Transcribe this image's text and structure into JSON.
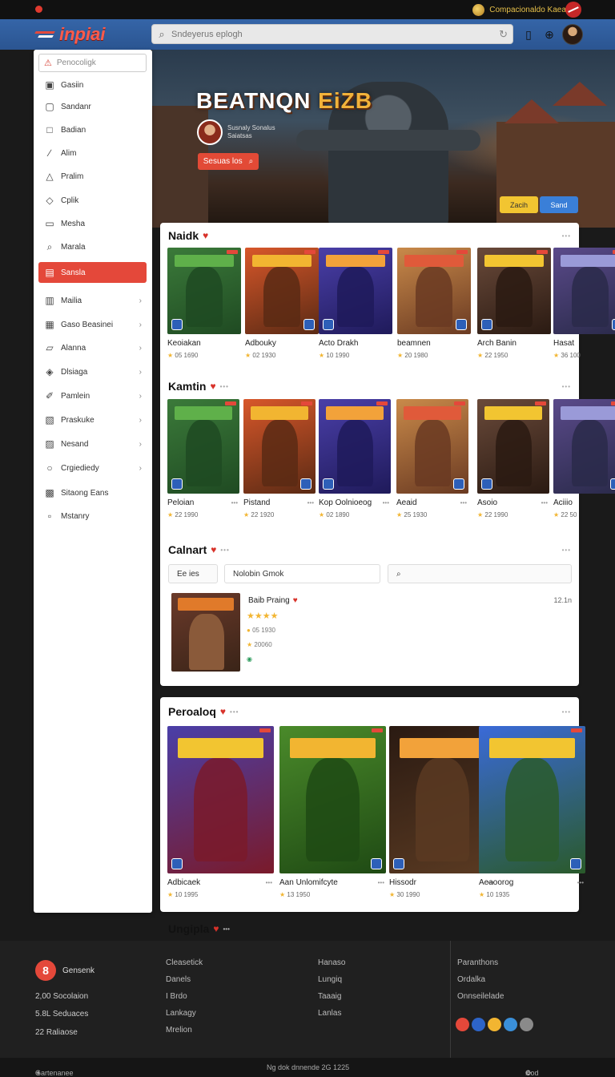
{
  "topbar": {
    "promo_text": "Compacionaldo Kaeal-9"
  },
  "header": {
    "logo_text": "inpiai",
    "search_placeholder": "Sndeyerus eplogh"
  },
  "hero": {
    "title_main": "BEATNQN ",
    "title_accent": "EiZB",
    "profile_line1": "Susnaly Sonalus",
    "profile_line2": "Saiatsas",
    "cta_label": "Sesuas los",
    "pill_yellow": "Zacih",
    "pill_blue": "Sand"
  },
  "sidebar": {
    "search_placeholder": "Penocoligk",
    "items": [
      {
        "label": "Gasiin",
        "icon": "gamepad-icon"
      },
      {
        "label": "Sandanr",
        "icon": "dice-icon"
      },
      {
        "label": "Badian",
        "icon": "box-icon"
      },
      {
        "label": "Alim",
        "icon": "sword-icon"
      },
      {
        "label": "Pralim",
        "icon": "tent-icon"
      },
      {
        "label": "Cplik",
        "icon": "controller-icon"
      },
      {
        "label": "Mesha",
        "icon": "monitor-icon"
      },
      {
        "label": "Marala",
        "icon": "search-icon"
      },
      {
        "label": "Sansla",
        "icon": "star-icon"
      },
      {
        "label": "Mailia",
        "icon": "card-icon"
      },
      {
        "label": "Gaso Beasinei",
        "icon": "store-icon"
      },
      {
        "label": "Alanna",
        "icon": "shield-icon"
      },
      {
        "label": "Dlsiaga",
        "icon": "puzzle-icon"
      },
      {
        "label": "Pamlein",
        "icon": "brush-icon"
      },
      {
        "label": "Praskuke",
        "icon": "film-icon"
      },
      {
        "label": "Nesand",
        "icon": "layers-icon"
      },
      {
        "label": "Crgiediedy",
        "icon": "globe-icon"
      },
      {
        "label": "Sitaong Eans",
        "icon": "users-icon"
      },
      {
        "label": "Mstanry",
        "icon": "book-icon"
      }
    ]
  },
  "sections": {
    "naidk": {
      "title": "Naidk",
      "cards": [
        {
          "name": "Keoiakan",
          "rating": "05 1690"
        },
        {
          "name": "Adbouky",
          "rating": "02 1930"
        },
        {
          "name": "Acto Drakh",
          "rating": "10 1990"
        },
        {
          "name": "beamnen",
          "rating": "20 1980"
        },
        {
          "name": "Arch Banin",
          "rating": "22 1950"
        },
        {
          "name": "Hasat",
          "rating": "36 100"
        }
      ]
    },
    "kamtin": {
      "title": "Kamtin",
      "cards": [
        {
          "name": "Peloian",
          "rating": "22 1990"
        },
        {
          "name": "Pistand",
          "rating": "22 1920"
        },
        {
          "name": "Kop Oolnioeog",
          "rating": "02 1890"
        },
        {
          "name": "Aeaid",
          "rating": "25 1930"
        },
        {
          "name": "Asoio",
          "rating": "22 1990"
        },
        {
          "name": "Aciiio",
          "rating": "22 50"
        }
      ]
    },
    "calnart": {
      "title": "Calnart",
      "filter_label": "Ee ies",
      "filter_value": "Nolobin Gmok",
      "item": {
        "title": "Baib Praing",
        "stars": "★★★★",
        "line1": "05 1930",
        "line2": "20060",
        "time": "12.1n"
      }
    },
    "peroalog": {
      "title": "Peroaloq",
      "cards": [
        {
          "name": "Adbicaek",
          "rating": "10 1995"
        },
        {
          "name": "Aan Unlomifcyte",
          "rating": "13 1950"
        },
        {
          "name": "Hissodr",
          "rating": "30 1990"
        },
        {
          "name": "Aeaoorog",
          "rating": "10 1935"
        }
      ]
    },
    "next_title": "Ungipla"
  },
  "footer": {
    "brand": "Gensenk",
    "stats": [
      "2,00 Socolaion",
      "5.8L Seduaces",
      "22 Raliaose"
    ],
    "col1": [
      "Cleasetick",
      "Danels",
      "I Brdo",
      "Lankagy",
      "Mrelion"
    ],
    "col2": [
      "Hanaso",
      "Lungiq",
      "Taaaig",
      "Lanlas"
    ],
    "col3": [
      "Paranthons",
      "Ordalka",
      "Onnseilelade"
    ],
    "bottom_left": "Gartenanee",
    "bottom_center": "Ng dok dnnende  2G 1225",
    "bottom_right": "Cod Sosa"
  },
  "colors": {
    "accent_red": "#e4483a",
    "header_blue": "#2f5c9d",
    "star_gold": "#f2b531"
  }
}
